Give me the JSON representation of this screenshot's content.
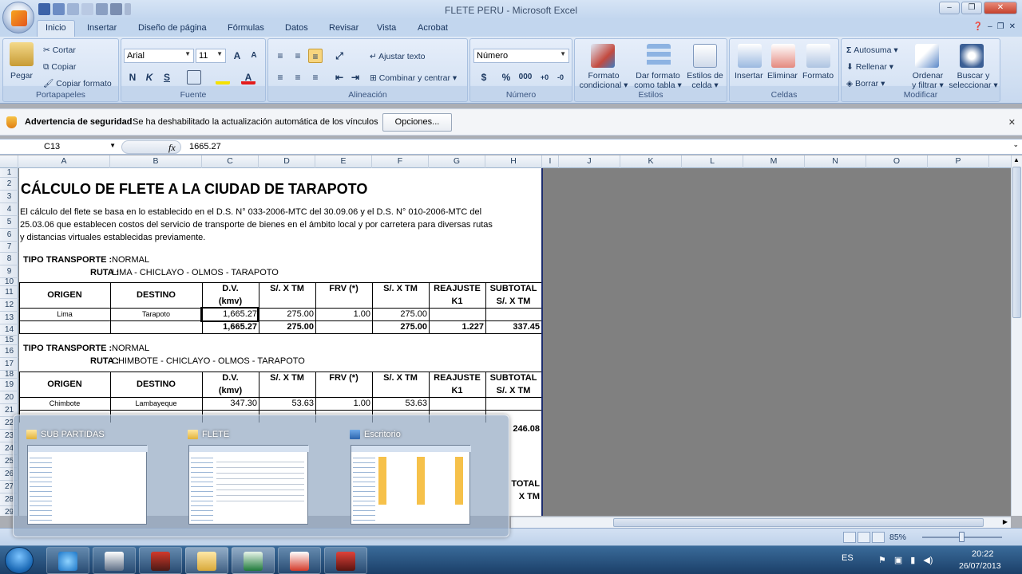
{
  "window": {
    "title": "FLETE PERU - Microsoft Excel"
  },
  "tabs": [
    "Inicio",
    "Insertar",
    "Diseño de página",
    "Fórmulas",
    "Datos",
    "Revisar",
    "Vista",
    "Acrobat"
  ],
  "ribbon": {
    "portapapeles": {
      "label": "Portapapeles",
      "pegar": "Pegar",
      "cortar": "Cortar",
      "copiar": "Copiar",
      "copiar_formato": "Copiar formato"
    },
    "fuente": {
      "label": "Fuente",
      "font": "Arial",
      "size": "11",
      "bold": "N",
      "italic": "K",
      "underline": "S"
    },
    "alineacion": {
      "label": "Alineación",
      "ajustar": "Ajustar texto",
      "combinar": "Combinar y centrar"
    },
    "numero": {
      "label": "Número",
      "format": "Número",
      "percent": "%",
      "thousands": "000"
    },
    "estilos": {
      "label": "Estilos",
      "formato_cond_1": "Formato",
      "formato_cond_2": "condicional",
      "dar_formato_1": "Dar formato",
      "dar_formato_2": "como tabla",
      "estilos_celda_1": "Estilos de",
      "estilos_celda_2": "celda"
    },
    "celdas": {
      "label": "Celdas",
      "insertar": "Insertar",
      "eliminar": "Eliminar",
      "formato": "Formato"
    },
    "modificar": {
      "label": "Modificar",
      "autosuma": "Autosuma",
      "rellenar": "Rellenar",
      "borrar": "Borrar",
      "ordenar_1": "Ordenar",
      "ordenar_2": "y filtrar",
      "buscar_1": "Buscar y",
      "buscar_2": "seleccionar"
    }
  },
  "security": {
    "title": "Advertencia de seguridad",
    "message": "Se ha deshabilitado la actualización automática de los vínculos",
    "button": "Opciones..."
  },
  "formula_bar": {
    "name_box": "C13",
    "fx": "fx",
    "formula": "1665.27"
  },
  "columns": [
    "A",
    "B",
    "C",
    "D",
    "E",
    "F",
    "G",
    "H",
    "I",
    "J",
    "K",
    "L",
    "M",
    "N",
    "O",
    "P"
  ],
  "rows": [
    "1",
    "2",
    "3",
    "4",
    "5",
    "6",
    "7",
    "8",
    "9",
    "10",
    "11",
    "12",
    "13",
    "14",
    "15",
    "16",
    "17",
    "18",
    "19",
    "20",
    "21",
    "22",
    "23",
    "24",
    "25",
    "26",
    "27",
    "28",
    "29"
  ],
  "sheet": {
    "title": "CÁLCULO DE FLETE A LA CIUDAD DE TARAPOTO",
    "para1": "El cálculo del flete se basa en lo establecido en el D.S. N° 033-2006-MTC del 30.09.06 y el D.S. N° 010-2006-MTC del",
    "para2": "25.03.06 que establecen costos del servicio de transporte de bienes en el ámbito local y por carretera para diversas rutas",
    "para3": "y distancias virtuales establecidas previamente.",
    "tipo_label": "TIPO TRANSPORTE :",
    "ruta_label": "RUTA :",
    "h_origen": "ORIGEN",
    "h_destino": "DESTINO",
    "h_dv": "D.V.",
    "h_kmv": "(kmv)",
    "h_sxtm": "S/. X TM",
    "h_frv": "FRV (*)",
    "h_reajuste": "REAJUSTE",
    "h_k1": "K1",
    "h_subtotal": "SUBTOTAL",
    "h_sxtm2": "S/. X TM",
    "block1": {
      "tipo": "NORMAL",
      "ruta": "LIMA - CHICLAYO - OLMOS - TARAPOTO",
      "r1": {
        "origen": "Lima",
        "destino": "Tarapoto",
        "dv": "1,665.27",
        "sxtm": "275.00",
        "frv": "1.00",
        "sxtm2": "275.00"
      },
      "tot": {
        "dv": "1,665.27",
        "sxtm": "275.00",
        "sxtm2": "275.00",
        "k1": "1.227",
        "subtotal": "337.45"
      }
    },
    "block2": {
      "tipo": "NORMAL",
      "ruta": "CHIMBOTE - CHICLAYO - OLMOS - TARAPOTO",
      "r1": {
        "origen": "Chimbote",
        "destino": "Lambayeque",
        "dv": "347.30",
        "sxtm": "53.63",
        "frv": "1.00",
        "sxtm2": "53.63"
      },
      "subtotal": "246.08"
    },
    "partial1": "TOTAL",
    "partial2": "X TM"
  },
  "status": {
    "zoom": "85%"
  },
  "thumbnails": [
    {
      "title": "SUB PARTIDAS"
    },
    {
      "title": "FLETE"
    },
    {
      "title": "Escritorio"
    }
  ],
  "tray": {
    "lang": "ES",
    "time": "20:22",
    "date": "26/07/2013"
  },
  "colors": {
    "accent": "#1d2d6e",
    "excel_green": "#1f7a3a"
  }
}
